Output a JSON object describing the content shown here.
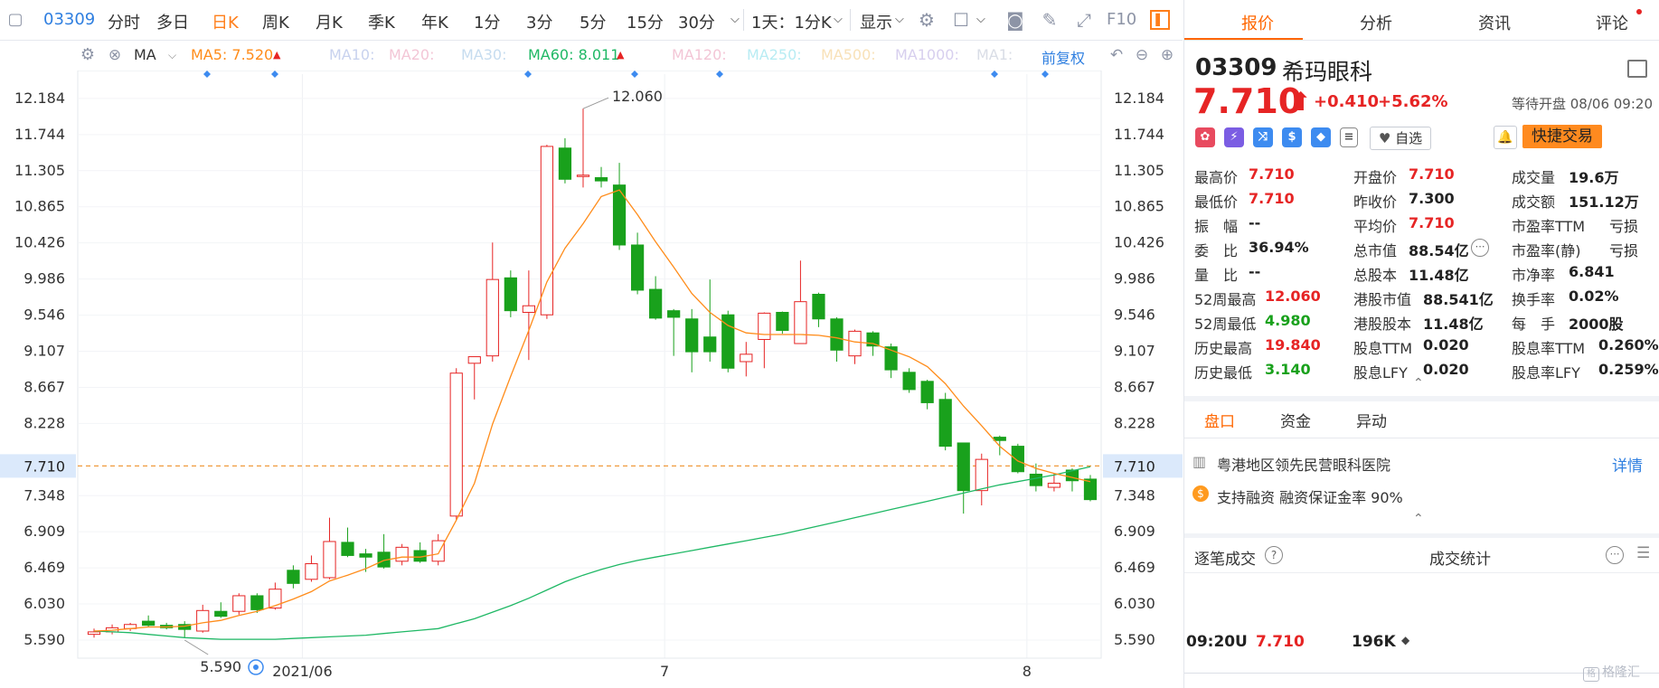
{
  "toolbar": {
    "code": "03309",
    "items": [
      "分时",
      "多日",
      "日K",
      "周K",
      "月K",
      "季K",
      "年K",
      "1分",
      "3分",
      "5分",
      "15分",
      "30分"
    ],
    "active": "日K",
    "period": "1天：1分K",
    "display": "显示",
    "f10": "F10"
  },
  "mabar": {
    "ma_label": "MA",
    "ma5": "MA5: 7.520",
    "ma10": "MA10:",
    "ma20": "MA20:",
    "ma30": "MA30:",
    "ma60": "MA60: 8.011",
    "ma120": "MA120:",
    "ma250": "MA250:",
    "ma500": "MA500:",
    "ma1000": "MA1000:",
    "ma1x": "MA1:",
    "restore": "前复权"
  },
  "colors": {
    "up": "#e62424",
    "down": "#19a11c",
    "ma5": "#ff8c1a",
    "ma60": "#1fb865",
    "accent": "#ff7e1a",
    "link": "#2f7fe0"
  },
  "chart_data": {
    "type": "candlestick",
    "y_ticks": [
      "12.184",
      "11.744",
      "11.305",
      "10.865",
      "10.426",
      "9.986",
      "9.546",
      "9.107",
      "8.667",
      "8.228",
      "7.710",
      "7.348",
      "6.909",
      "6.469",
      "6.030",
      "5.590"
    ],
    "ylim": [
      5.37,
      12.48
    ],
    "current_price": "7.710",
    "x_labels": [
      "2021/06",
      "7",
      "8"
    ],
    "high_annotation": "12.060",
    "low_annotation": "5.590",
    "candles": [
      [
        5.66,
        5.69,
        5.62,
        5.73
      ],
      [
        5.69,
        5.74,
        5.66,
        5.78
      ],
      [
        5.73,
        5.78,
        5.7,
        5.8
      ],
      [
        5.82,
        5.77,
        5.75,
        5.89
      ],
      [
        5.77,
        5.74,
        5.72,
        5.8
      ],
      [
        5.78,
        5.72,
        5.62,
        5.82
      ],
      [
        5.7,
        5.95,
        5.68,
        6.02
      ],
      [
        5.94,
        5.88,
        5.86,
        6.05
      ],
      [
        5.94,
        6.13,
        5.9,
        6.16
      ],
      [
        6.13,
        5.96,
        5.92,
        6.16
      ],
      [
        5.98,
        6.21,
        5.96,
        6.29
      ],
      [
        6.44,
        6.28,
        6.22,
        6.5
      ],
      [
        6.33,
        6.52,
        6.3,
        6.62
      ],
      [
        6.35,
        6.79,
        6.33,
        7.08
      ],
      [
        6.78,
        6.62,
        6.6,
        6.96
      ],
      [
        6.64,
        6.6,
        6.42,
        6.7
      ],
      [
        6.66,
        6.48,
        6.46,
        6.88
      ],
      [
        6.55,
        6.72,
        6.5,
        6.76
      ],
      [
        6.68,
        6.55,
        6.53,
        6.78
      ],
      [
        6.55,
        6.8,
        6.5,
        6.88
      ],
      [
        7.1,
        8.84,
        7.05,
        8.9
      ],
      [
        8.96,
        9.04,
        8.52,
        9.04
      ],
      [
        9.05,
        9.98,
        8.98,
        10.43
      ],
      [
        10.0,
        9.6,
        9.52,
        10.09
      ],
      [
        9.58,
        9.66,
        9.0,
        10.09
      ],
      [
        9.55,
        11.6,
        9.5,
        11.62
      ],
      [
        11.58,
        11.2,
        11.15,
        11.7
      ],
      [
        11.25,
        11.25,
        11.1,
        12.06
      ],
      [
        11.22,
        11.18,
        11.1,
        11.35
      ],
      [
        11.13,
        10.4,
        10.34,
        11.4
      ],
      [
        10.4,
        9.85,
        9.8,
        10.55
      ],
      [
        9.86,
        9.51,
        9.49,
        10.02
      ],
      [
        9.6,
        9.52,
        9.05,
        9.62
      ],
      [
        9.5,
        9.1,
        8.85,
        9.62
      ],
      [
        9.28,
        9.1,
        8.98,
        9.98
      ],
      [
        9.55,
        8.9,
        8.85,
        9.6
      ],
      [
        8.98,
        9.07,
        8.8,
        9.22
      ],
      [
        9.25,
        9.57,
        8.9,
        9.58
      ],
      [
        9.58,
        9.36,
        9.32,
        9.59
      ],
      [
        9.2,
        9.71,
        9.2,
        10.21
      ],
      [
        9.8,
        9.5,
        9.4,
        9.82
      ],
      [
        9.5,
        9.12,
        8.98,
        9.52
      ],
      [
        9.05,
        9.35,
        8.95,
        9.37
      ],
      [
        9.33,
        9.17,
        9.05,
        9.35
      ],
      [
        9.16,
        8.88,
        8.78,
        9.2
      ],
      [
        8.85,
        8.64,
        8.6,
        8.9
      ],
      [
        8.74,
        8.48,
        8.4,
        8.76
      ],
      [
        8.52,
        7.95,
        7.9,
        8.6
      ],
      [
        7.99,
        7.41,
        7.13,
        7.99
      ],
      [
        7.41,
        7.79,
        7.23,
        7.86
      ],
      [
        8.06,
        8.02,
        7.84,
        8.08
      ],
      [
        7.95,
        7.64,
        7.62,
        7.98
      ],
      [
        7.61,
        7.47,
        7.4,
        7.74
      ],
      [
        7.45,
        7.5,
        7.4,
        7.62
      ],
      [
        7.66,
        7.53,
        7.4,
        7.68
      ],
      [
        7.55,
        7.3,
        7.28,
        7.6
      ]
    ],
    "ma5": [
      5.7,
      5.71,
      5.73,
      5.75,
      5.75,
      5.76,
      5.8,
      5.83,
      5.89,
      5.94,
      6.01,
      6.09,
      6.18,
      6.31,
      6.38,
      6.46,
      6.56,
      6.6,
      6.6,
      6.64,
      7.05,
      7.5,
      8.22,
      8.8,
      9.36,
      9.95,
      10.36,
      10.66,
      10.99,
      11.07,
      10.77,
      10.44,
      10.13,
      9.81,
      9.58,
      9.42,
      9.33,
      9.31,
      9.31,
      9.31,
      9.3,
      9.27,
      9.22,
      9.2,
      9.12,
      9.04,
      8.92,
      8.71,
      8.44,
      8.2,
      7.95,
      7.77,
      7.68,
      7.62,
      7.57,
      7.52
    ],
    "ma60": [
      5.7,
      5.69,
      5.68,
      5.66,
      5.64,
      5.62,
      5.61,
      5.6,
      5.6,
      5.6,
      5.6,
      5.61,
      5.62,
      5.63,
      5.64,
      5.65,
      5.67,
      5.69,
      5.71,
      5.73,
      5.79,
      5.85,
      5.93,
      6.01,
      6.1,
      6.2,
      6.3,
      6.38,
      6.45,
      6.51,
      6.56,
      6.6,
      6.64,
      6.68,
      6.72,
      6.76,
      6.8,
      6.84,
      6.88,
      6.93,
      6.98,
      7.03,
      7.08,
      7.13,
      7.18,
      7.23,
      7.28,
      7.33,
      7.38,
      7.43,
      7.48,
      7.52,
      7.56,
      7.6,
      7.65,
      7.7
    ]
  },
  "stock": {
    "code": "03309",
    "name": "希玛眼科",
    "price": "7.710",
    "arrow": "⬆",
    "change": "+0.410",
    "pct": "+5.62%",
    "status": "等待开盘 08/06 09:20",
    "watch": "自选",
    "quick_trade": "快捷交易"
  },
  "tabs": {
    "quote": "报价",
    "analysis": "分析",
    "news": "资讯",
    "comments": "评论"
  },
  "stats": {
    "high_l": "最高价",
    "high": "7.710",
    "open_l": "开盘价",
    "open": "7.710",
    "vol_l": "成交量",
    "vol": "19.6万",
    "low_l": "最低价",
    "low": "7.710",
    "prev_l": "昨收价",
    "prev": "7.300",
    "amt_l": "成交额",
    "amt": "151.12万",
    "amp_l": "振　幅",
    "amp": "--",
    "avg_l": "平均价",
    "avg": "7.710",
    "pe_ttm_l": "市盈率TTM",
    "pe_ttm": "亏损",
    "wb_l": "委　比",
    "wb": "36.94%",
    "mcap_l": "总市值",
    "mcap": "88.54亿",
    "pe_s_l": "市盈率(静)",
    "pe_s": "亏损",
    "lb_l": "量　比",
    "lb": "--",
    "shares_l": "总股本",
    "shares": "11.48亿",
    "pb_l": "市净率",
    "pb": "6.841",
    "h52_l": "52周最高",
    "h52": "12.060",
    "hkmcap_l": "港股市值",
    "hkmcap": "88.541亿",
    "turn_l": "换手率",
    "turn": "0.02%",
    "l52_l": "52周最低",
    "l52": "4.980",
    "hkshares_l": "港股股本",
    "hkshares": "11.48亿",
    "lot_l": "每　手",
    "lot": "2000股",
    "hh_l": "历史最高",
    "hh": "19.840",
    "divttm_l": "股息TTM",
    "divttm": "0.020",
    "dyttm_l": "股息率TTM",
    "dyttm": "0.260%",
    "hl_l": "历史最低",
    "hl": "3.140",
    "divlfy_l": "股息LFY",
    "divlfy": "0.020",
    "dylfy_l": "股息率LFY",
    "dylfy": "0.259%"
  },
  "panel2": {
    "tabs": [
      "盘口",
      "资金",
      "异动"
    ],
    "desc": "粤港地区领先民营眼科医院",
    "detail": "详情",
    "margin": "支持融资  融资保证金率 90%"
  },
  "panel3": {
    "title": "逐笔成交",
    "stats": "成交统计",
    "trade_time": "09:20",
    "trade_flag": "U",
    "trade_price": "7.710",
    "trade_vol": "196K"
  },
  "watermark": "格隆汇"
}
